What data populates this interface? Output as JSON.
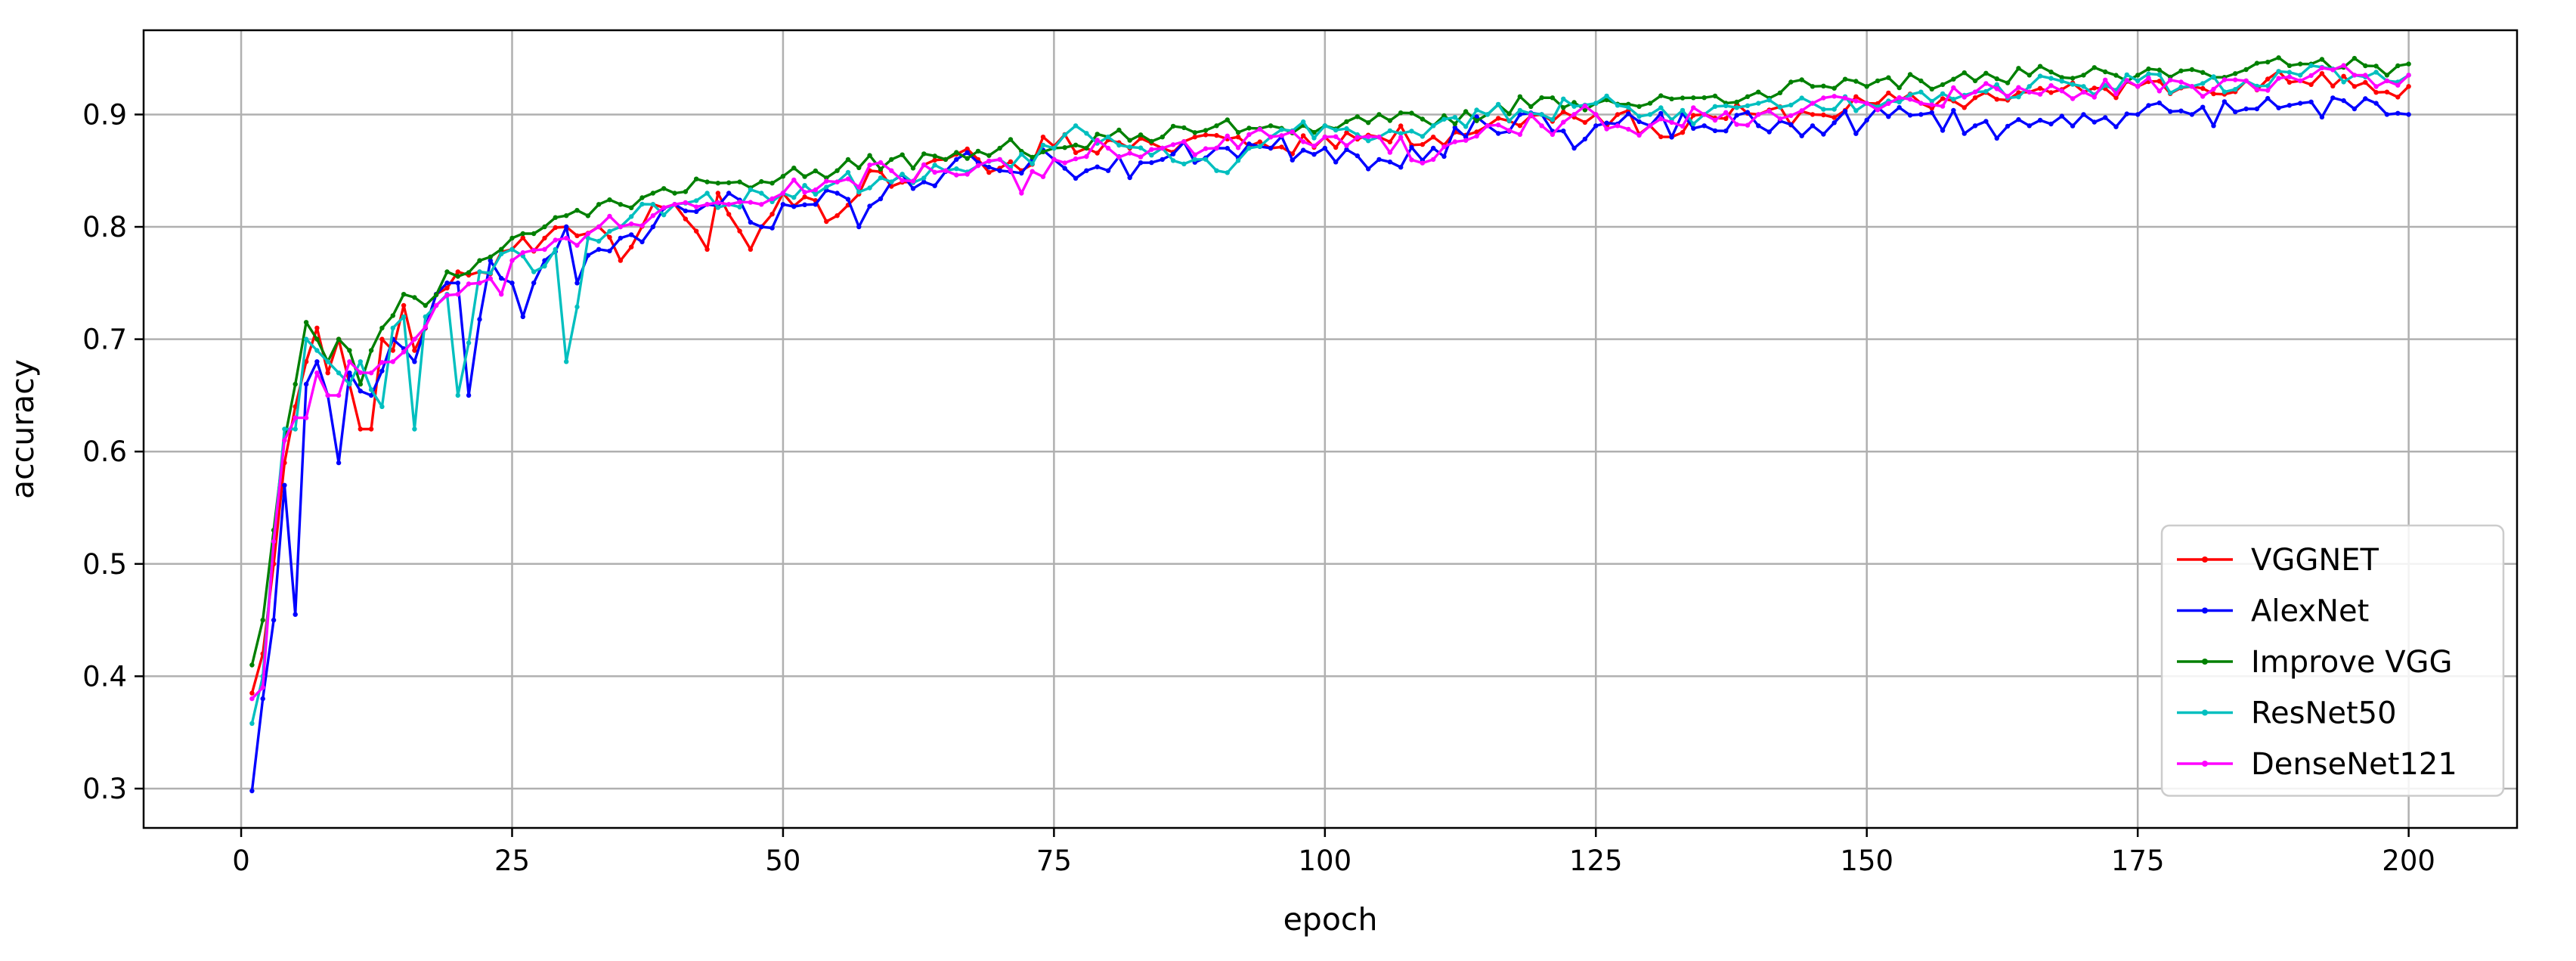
{
  "chart_data": {
    "type": "line",
    "xlabel": "epoch",
    "ylabel": "accuracy",
    "xlim": [
      -9,
      210
    ],
    "ylim": [
      0.265,
      0.975
    ],
    "xticks": [
      "0",
      "25",
      "50",
      "75",
      "100",
      "125",
      "150",
      "175",
      "200"
    ],
    "yticks": [
      "0.3",
      "0.4",
      "0.5",
      "0.6",
      "0.7",
      "0.8",
      "0.9"
    ],
    "grid": true,
    "legend_position": "lower-right",
    "series": [
      {
        "name": "VGGNET",
        "color": "#ff0000",
        "anchors": [
          [
            1,
            0.385
          ],
          [
            2,
            0.42
          ],
          [
            3,
            0.5
          ],
          [
            4,
            0.59
          ],
          [
            5,
            0.64
          ],
          [
            6,
            0.68
          ],
          [
            7,
            0.71
          ],
          [
            8,
            0.67
          ],
          [
            9,
            0.7
          ],
          [
            10,
            0.66
          ],
          [
            11,
            0.62
          ],
          [
            12,
            0.62
          ],
          [
            13,
            0.7
          ],
          [
            14,
            0.69
          ],
          [
            15,
            0.73
          ],
          [
            16,
            0.69
          ],
          [
            18,
            0.74
          ],
          [
            20,
            0.76
          ],
          [
            22,
            0.76
          ],
          [
            25,
            0.78
          ],
          [
            28,
            0.79
          ],
          [
            30,
            0.8
          ],
          [
            33,
            0.8
          ],
          [
            35,
            0.77
          ],
          [
            38,
            0.82
          ],
          [
            40,
            0.82
          ],
          [
            43,
            0.78
          ],
          [
            44,
            0.83
          ],
          [
            47,
            0.78
          ],
          [
            50,
            0.83
          ],
          [
            55,
            0.81
          ],
          [
            58,
            0.85
          ],
          [
            62,
            0.84
          ],
          [
            65,
            0.86
          ],
          [
            68,
            0.86
          ],
          [
            72,
            0.85
          ],
          [
            74,
            0.88
          ],
          [
            78,
            0.87
          ],
          [
            82,
            0.87
          ],
          [
            85,
            0.87
          ],
          [
            88,
            0.88
          ],
          [
            92,
            0.88
          ],
          [
            95,
            0.87
          ],
          [
            100,
            0.88
          ],
          [
            105,
            0.88
          ],
          [
            110,
            0.88
          ],
          [
            115,
            0.89
          ],
          [
            120,
            0.9
          ],
          [
            125,
            0.9
          ],
          [
            130,
            0.89
          ],
          [
            132,
            0.88
          ],
          [
            135,
            0.9
          ],
          [
            140,
            0.9
          ],
          [
            145,
            0.9
          ],
          [
            150,
            0.91
          ],
          [
            155,
            0.91
          ],
          [
            160,
            0.915
          ],
          [
            165,
            0.92
          ],
          [
            170,
            0.92
          ],
          [
            175,
            0.925
          ],
          [
            180,
            0.925
          ],
          [
            185,
            0.93
          ],
          [
            190,
            0.93
          ],
          [
            195,
            0.925
          ],
          [
            198,
            0.92
          ],
          [
            200,
            0.925
          ]
        ],
        "noise": 0.01,
        "seed": 11
      },
      {
        "name": "AlexNet",
        "color": "#0000ff",
        "anchors": [
          [
            1,
            0.298
          ],
          [
            2,
            0.38
          ],
          [
            3,
            0.45
          ],
          [
            4,
            0.57
          ],
          [
            5,
            0.455
          ],
          [
            6,
            0.66
          ],
          [
            7,
            0.68
          ],
          [
            8,
            0.65
          ],
          [
            9,
            0.59
          ],
          [
            10,
            0.67
          ],
          [
            12,
            0.65
          ],
          [
            14,
            0.7
          ],
          [
            16,
            0.68
          ],
          [
            18,
            0.74
          ],
          [
            20,
            0.75
          ],
          [
            21,
            0.65
          ],
          [
            23,
            0.77
          ],
          [
            25,
            0.75
          ],
          [
            26,
            0.72
          ],
          [
            28,
            0.77
          ],
          [
            30,
            0.8
          ],
          [
            31,
            0.75
          ],
          [
            33,
            0.78
          ],
          [
            35,
            0.79
          ],
          [
            38,
            0.8
          ],
          [
            40,
            0.82
          ],
          [
            43,
            0.82
          ],
          [
            45,
            0.83
          ],
          [
            48,
            0.8
          ],
          [
            50,
            0.82
          ],
          [
            53,
            0.82
          ],
          [
            55,
            0.83
          ],
          [
            57,
            0.8
          ],
          [
            60,
            0.84
          ],
          [
            63,
            0.84
          ],
          [
            66,
            0.86
          ],
          [
            70,
            0.85
          ],
          [
            73,
            0.86
          ],
          [
            75,
            0.86
          ],
          [
            78,
            0.85
          ],
          [
            80,
            0.85
          ],
          [
            85,
            0.86
          ],
          [
            90,
            0.87
          ],
          [
            95,
            0.87
          ],
          [
            100,
            0.87
          ],
          [
            105,
            0.86
          ],
          [
            110,
            0.87
          ],
          [
            115,
            0.89
          ],
          [
            118,
            0.9
          ],
          [
            120,
            0.9
          ],
          [
            123,
            0.87
          ],
          [
            125,
            0.89
          ],
          [
            130,
            0.89
          ],
          [
            135,
            0.89
          ],
          [
            140,
            0.89
          ],
          [
            145,
            0.89
          ],
          [
            150,
            0.895
          ],
          [
            155,
            0.9
          ],
          [
            160,
            0.89
          ],
          [
            165,
            0.89
          ],
          [
            170,
            0.9
          ],
          [
            175,
            0.9
          ],
          [
            180,
            0.9
          ],
          [
            185,
            0.905
          ],
          [
            190,
            0.91
          ],
          [
            195,
            0.905
          ],
          [
            198,
            0.9
          ],
          [
            200,
            0.9
          ]
        ],
        "noise": 0.012,
        "seed": 23
      },
      {
        "name": "Improve VGG",
        "color": "#008000",
        "anchors": [
          [
            1,
            0.41
          ],
          [
            2,
            0.45
          ],
          [
            3,
            0.53
          ],
          [
            4,
            0.61
          ],
          [
            5,
            0.66
          ],
          [
            6,
            0.715
          ],
          [
            7,
            0.7
          ],
          [
            8,
            0.68
          ],
          [
            9,
            0.7
          ],
          [
            10,
            0.69
          ],
          [
            11,
            0.66
          ],
          [
            12,
            0.69
          ],
          [
            13,
            0.71
          ],
          [
            15,
            0.74
          ],
          [
            17,
            0.73
          ],
          [
            19,
            0.76
          ],
          [
            22,
            0.77
          ],
          [
            25,
            0.79
          ],
          [
            28,
            0.8
          ],
          [
            30,
            0.81
          ],
          [
            33,
            0.82
          ],
          [
            35,
            0.82
          ],
          [
            38,
            0.83
          ],
          [
            40,
            0.83
          ],
          [
            43,
            0.84
          ],
          [
            46,
            0.84
          ],
          [
            50,
            0.845
          ],
          [
            55,
            0.85
          ],
          [
            60,
            0.86
          ],
          [
            65,
            0.86
          ],
          [
            70,
            0.87
          ],
          [
            75,
            0.87
          ],
          [
            80,
            0.88
          ],
          [
            85,
            0.88
          ],
          [
            90,
            0.89
          ],
          [
            95,
            0.89
          ],
          [
            100,
            0.89
          ],
          [
            105,
            0.9
          ],
          [
            110,
            0.89
          ],
          [
            115,
            0.9
          ],
          [
            120,
            0.915
          ],
          [
            125,
            0.91
          ],
          [
            130,
            0.91
          ],
          [
            135,
            0.915
          ],
          [
            140,
            0.92
          ],
          [
            145,
            0.925
          ],
          [
            150,
            0.925
          ],
          [
            155,
            0.93
          ],
          [
            160,
            0.93
          ],
          [
            165,
            0.935
          ],
          [
            170,
            0.935
          ],
          [
            175,
            0.935
          ],
          [
            180,
            0.94
          ],
          [
            185,
            0.94
          ],
          [
            190,
            0.945
          ],
          [
            195,
            0.95
          ],
          [
            198,
            0.935
          ],
          [
            200,
            0.945
          ]
        ],
        "noise": 0.008,
        "seed": 37
      },
      {
        "name": "ResNet50",
        "color": "#00bfbf",
        "anchors": [
          [
            1,
            0.358
          ],
          [
            2,
            0.4
          ],
          [
            3,
            0.52
          ],
          [
            4,
            0.62
          ],
          [
            5,
            0.62
          ],
          [
            6,
            0.7
          ],
          [
            7,
            0.69
          ],
          [
            8,
            0.68
          ],
          [
            9,
            0.67
          ],
          [
            10,
            0.66
          ],
          [
            11,
            0.68
          ],
          [
            13,
            0.64
          ],
          [
            14,
            0.71
          ],
          [
            15,
            0.72
          ],
          [
            16,
            0.62
          ],
          [
            17,
            0.72
          ],
          [
            18,
            0.73
          ],
          [
            19,
            0.74
          ],
          [
            20,
            0.65
          ],
          [
            22,
            0.76
          ],
          [
            25,
            0.78
          ],
          [
            27,
            0.76
          ],
          [
            29,
            0.78
          ],
          [
            30,
            0.68
          ],
          [
            32,
            0.79
          ],
          [
            35,
            0.8
          ],
          [
            38,
            0.82
          ],
          [
            40,
            0.82
          ],
          [
            43,
            0.83
          ],
          [
            45,
            0.82
          ],
          [
            48,
            0.83
          ],
          [
            50,
            0.83
          ],
          [
            55,
            0.84
          ],
          [
            60,
            0.84
          ],
          [
            65,
            0.85
          ],
          [
            70,
            0.86
          ],
          [
            75,
            0.87
          ],
          [
            77,
            0.89
          ],
          [
            80,
            0.88
          ],
          [
            85,
            0.87
          ],
          [
            88,
            0.86
          ],
          [
            90,
            0.85
          ],
          [
            93,
            0.87
          ],
          [
            95,
            0.88
          ],
          [
            100,
            0.89
          ],
          [
            105,
            0.88
          ],
          [
            110,
            0.89
          ],
          [
            115,
            0.9
          ],
          [
            120,
            0.9
          ],
          [
            125,
            0.91
          ],
          [
            130,
            0.9
          ],
          [
            135,
            0.9
          ],
          [
            140,
            0.91
          ],
          [
            145,
            0.91
          ],
          [
            150,
            0.91
          ],
          [
            155,
            0.92
          ],
          [
            160,
            0.92
          ],
          [
            165,
            0.925
          ],
          [
            170,
            0.925
          ],
          [
            175,
            0.93
          ],
          [
            180,
            0.925
          ],
          [
            185,
            0.93
          ],
          [
            190,
            0.935
          ],
          [
            195,
            0.935
          ],
          [
            198,
            0.93
          ],
          [
            200,
            0.935
          ]
        ],
        "noise": 0.01,
        "seed": 53
      },
      {
        "name": "DenseNet121",
        "color": "#ff00ff",
        "anchors": [
          [
            1,
            0.38
          ],
          [
            2,
            0.39
          ],
          [
            3,
            0.52
          ],
          [
            4,
            0.61
          ],
          [
            5,
            0.63
          ],
          [
            6,
            0.63
          ],
          [
            7,
            0.67
          ],
          [
            8,
            0.65
          ],
          [
            9,
            0.65
          ],
          [
            10,
            0.68
          ],
          [
            12,
            0.67
          ],
          [
            14,
            0.68
          ],
          [
            16,
            0.7
          ],
          [
            18,
            0.73
          ],
          [
            20,
            0.74
          ],
          [
            22,
            0.75
          ],
          [
            24,
            0.74
          ],
          [
            25,
            0.77
          ],
          [
            28,
            0.78
          ],
          [
            30,
            0.79
          ],
          [
            33,
            0.8
          ],
          [
            35,
            0.8
          ],
          [
            38,
            0.81
          ],
          [
            40,
            0.82
          ],
          [
            43,
            0.82
          ],
          [
            45,
            0.82
          ],
          [
            48,
            0.82
          ],
          [
            50,
            0.83
          ],
          [
            55,
            0.84
          ],
          [
            60,
            0.85
          ],
          [
            65,
            0.85
          ],
          [
            70,
            0.86
          ],
          [
            72,
            0.83
          ],
          [
            75,
            0.86
          ],
          [
            80,
            0.87
          ],
          [
            85,
            0.87
          ],
          [
            90,
            0.87
          ],
          [
            95,
            0.88
          ],
          [
            100,
            0.88
          ],
          [
            105,
            0.88
          ],
          [
            110,
            0.86
          ],
          [
            115,
            0.89
          ],
          [
            120,
            0.89
          ],
          [
            125,
            0.9
          ],
          [
            127,
            0.89
          ],
          [
            130,
            0.89
          ],
          [
            135,
            0.9
          ],
          [
            140,
            0.9
          ],
          [
            145,
            0.91
          ],
          [
            150,
            0.91
          ],
          [
            155,
            0.91
          ],
          [
            160,
            0.92
          ],
          [
            165,
            0.92
          ],
          [
            170,
            0.92
          ],
          [
            175,
            0.925
          ],
          [
            180,
            0.925
          ],
          [
            185,
            0.93
          ],
          [
            190,
            0.93
          ],
          [
            195,
            0.935
          ],
          [
            198,
            0.93
          ],
          [
            200,
            0.935
          ]
        ],
        "noise": 0.01,
        "seed": 71
      }
    ]
  }
}
